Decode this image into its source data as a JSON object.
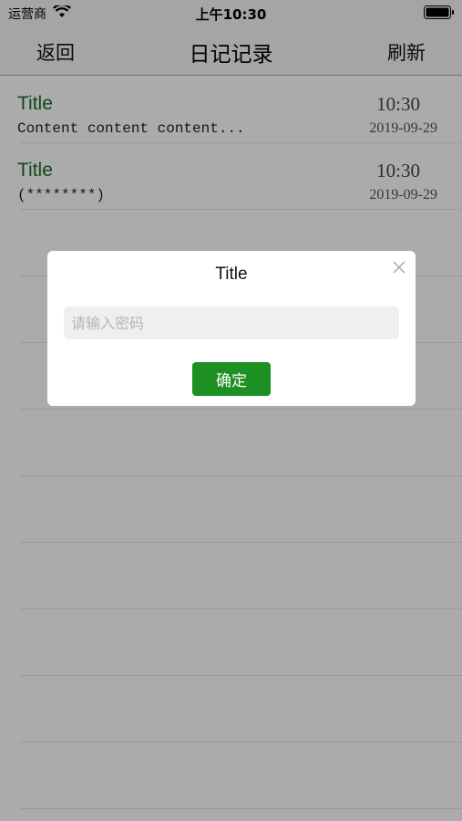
{
  "status_bar": {
    "carrier": "运营商",
    "time": "上午10:30",
    "wifi_icon": "wifi-icon",
    "battery_icon": "battery-icon"
  },
  "nav": {
    "back_label": "返回",
    "title": "日记记录",
    "refresh_label": "刷新"
  },
  "entries": [
    {
      "title": "Title",
      "content": "Content content content...",
      "time": "10:30",
      "date": "2019-09-29"
    },
    {
      "title": "Title",
      "content": "(********)",
      "time": "10:30",
      "date": "2019-09-29"
    }
  ],
  "dialog": {
    "title": "Title",
    "input_value": "",
    "input_placeholder": "请输入密码",
    "confirm_label": "确定",
    "close_icon": "close-icon"
  },
  "colors": {
    "accent": "#1e8f22",
    "entry_title": "#1f6b2a",
    "overlay": "rgba(0,0,0,0.33)"
  }
}
